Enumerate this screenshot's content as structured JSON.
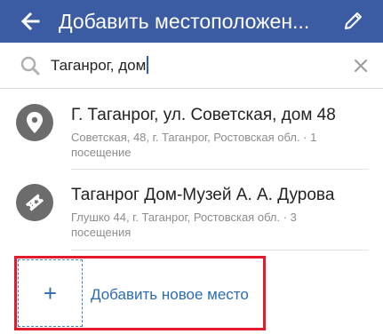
{
  "colors": {
    "appbar": "#3b5ba3",
    "accent": "#2b6cb5",
    "highlight": "#e21a2c"
  },
  "header": {
    "title": "Добавить местоположен...",
    "back_icon": "arrow-left-icon",
    "edit_icon": "pencil-icon"
  },
  "search": {
    "value": "Таганрог, дом",
    "search_icon": "search-icon",
    "clear_icon": "close-icon"
  },
  "results": [
    {
      "name": "Г. Таганрог, ул. Советская, дом 48",
      "subtitle": "Советская, 48, г. Таганрог, Ростовская обл. · 1 посещение",
      "icon": "map-pin-icon"
    },
    {
      "name": "Таганрог Дом-Музей А. А. Дурова",
      "subtitle": "Глушко 44, г. Таганрог, Ростовская обл. · 3 посещения",
      "icon": "ticket-icon"
    }
  ],
  "add_place": {
    "plus": "+",
    "label": "Добавить новое место"
  }
}
